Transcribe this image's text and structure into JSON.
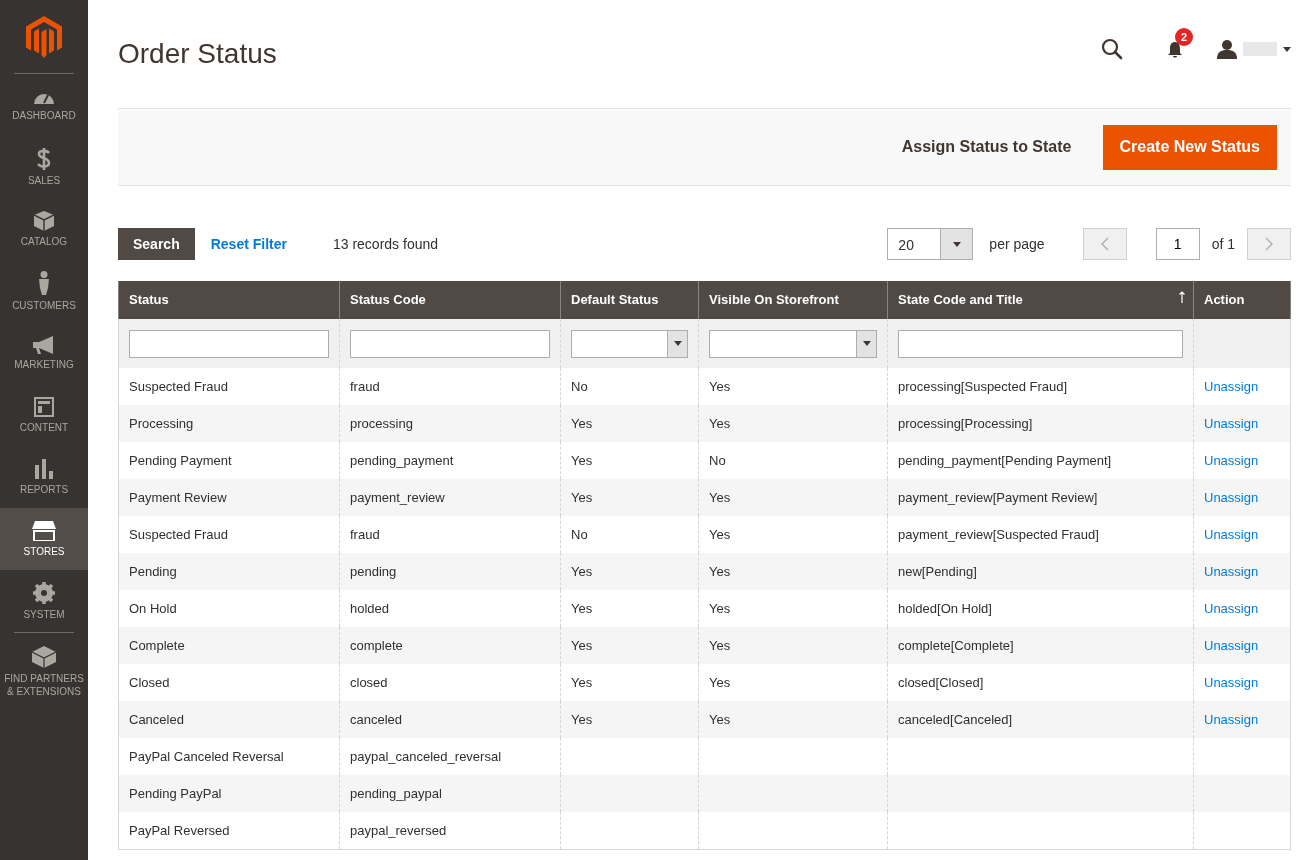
{
  "sidebar": {
    "items": [
      {
        "label": "DASHBOARD",
        "selected": false
      },
      {
        "label": "SALES",
        "selected": false
      },
      {
        "label": "CATALOG",
        "selected": false
      },
      {
        "label": "CUSTOMERS",
        "selected": false
      },
      {
        "label": "MARKETING",
        "selected": false
      },
      {
        "label": "CONTENT",
        "selected": false
      },
      {
        "label": "REPORTS",
        "selected": false
      },
      {
        "label": "STORES",
        "selected": true
      },
      {
        "label": "SYSTEM",
        "selected": false
      },
      {
        "label": "FIND PARTNERS & EXTENSIONS",
        "selected": false
      }
    ]
  },
  "page_title": "Order Status",
  "header": {
    "notification_count": "2"
  },
  "actions": {
    "assign": "Assign Status to State",
    "create": "Create New Status"
  },
  "grid_controls": {
    "search": "Search",
    "reset": "Reset Filter",
    "records": "13 records found",
    "per_page_value": "20",
    "per_page_label": "per page",
    "page": "1",
    "page_of": "of 1"
  },
  "table": {
    "columns": [
      {
        "label": "Status",
        "kind": "text",
        "sorted": false
      },
      {
        "label": "Status Code",
        "kind": "text",
        "sorted": false
      },
      {
        "label": "Default Status",
        "kind": "select",
        "sorted": false
      },
      {
        "label": "Visible On Storefront",
        "kind": "select",
        "sorted": false
      },
      {
        "label": "State Code and Title",
        "kind": "text",
        "sorted": true
      },
      {
        "label": "Action",
        "kind": "plain",
        "sorted": false
      }
    ],
    "rows": [
      {
        "status": "Suspected Fraud",
        "code": "fraud",
        "default": "No",
        "visible": "Yes",
        "state": "processing[Suspected Fraud]",
        "action": "Unassign"
      },
      {
        "status": "Processing",
        "code": "processing",
        "default": "Yes",
        "visible": "Yes",
        "state": "processing[Processing]",
        "action": "Unassign"
      },
      {
        "status": "Pending Payment",
        "code": "pending_payment",
        "default": "Yes",
        "visible": "No",
        "state": "pending_payment[Pending Payment]",
        "action": "Unassign"
      },
      {
        "status": "Payment Review",
        "code": "payment_review",
        "default": "Yes",
        "visible": "Yes",
        "state": "payment_review[Payment Review]",
        "action": "Unassign"
      },
      {
        "status": "Suspected Fraud",
        "code": "fraud",
        "default": "No",
        "visible": "Yes",
        "state": "payment_review[Suspected Fraud]",
        "action": "Unassign"
      },
      {
        "status": "Pending",
        "code": "pending",
        "default": "Yes",
        "visible": "Yes",
        "state": "new[Pending]",
        "action": "Unassign"
      },
      {
        "status": "On Hold",
        "code": "holded",
        "default": "Yes",
        "visible": "Yes",
        "state": "holded[On Hold]",
        "action": "Unassign"
      },
      {
        "status": "Complete",
        "code": "complete",
        "default": "Yes",
        "visible": "Yes",
        "state": "complete[Complete]",
        "action": "Unassign"
      },
      {
        "status": "Closed",
        "code": "closed",
        "default": "Yes",
        "visible": "Yes",
        "state": "closed[Closed]",
        "action": "Unassign"
      },
      {
        "status": "Canceled",
        "code": "canceled",
        "default": "Yes",
        "visible": "Yes",
        "state": "canceled[Canceled]",
        "action": "Unassign"
      },
      {
        "status": "PayPal Canceled Reversal",
        "code": "paypal_canceled_reversal"
      },
      {
        "status": "Pending PayPal",
        "code": "pending_paypal"
      },
      {
        "status": "PayPal Reversed",
        "code": "paypal_reversed"
      }
    ]
  }
}
